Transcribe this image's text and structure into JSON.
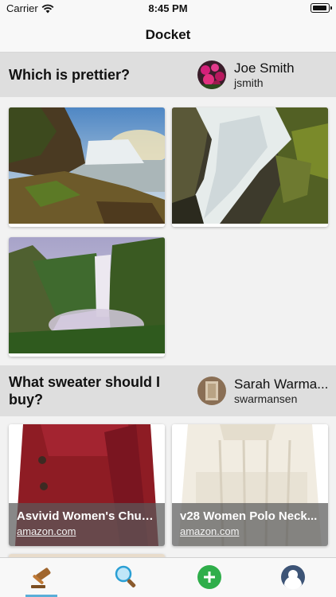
{
  "status_bar": {
    "carrier": "Carrier",
    "time": "8:45 PM"
  },
  "nav": {
    "title": "Docket"
  },
  "questions": [
    {
      "title": "Which is prettier?",
      "user": {
        "name": "Joe Smith",
        "handle": "jsmith"
      },
      "options": [
        {
          "type": "image",
          "subject": "waterfall-cliffs"
        },
        {
          "type": "image",
          "subject": "waterfall-closeup"
        },
        {
          "type": "image",
          "subject": "waterfall-valley"
        }
      ]
    },
    {
      "title": "What sweater should I buy?",
      "user": {
        "name": "Sarah Warmansen",
        "name_display": "Sarah Warma...",
        "handle": "swarmansen"
      },
      "options": [
        {
          "type": "product",
          "title": "Asvivid Women's Chunky Knit",
          "title_display": "Asvivid Women's Chun...",
          "domain": "amazon.com",
          "color": "#8e1c24"
        },
        {
          "type": "product",
          "title": "v28 Women Polo Neck Sweater",
          "title_display": "v28 Women Polo Neck...",
          "domain": "amazon.com",
          "color": "#f1ece1"
        }
      ]
    }
  ],
  "tabs": [
    {
      "name": "gavel-icon",
      "active": true
    },
    {
      "name": "search-icon",
      "active": false
    },
    {
      "name": "add-icon",
      "active": false
    },
    {
      "name": "profile-icon",
      "active": false
    }
  ],
  "colors": {
    "accent": "#5aaed8",
    "add_green": "#2fae4a",
    "header_bg": "#dedede"
  }
}
